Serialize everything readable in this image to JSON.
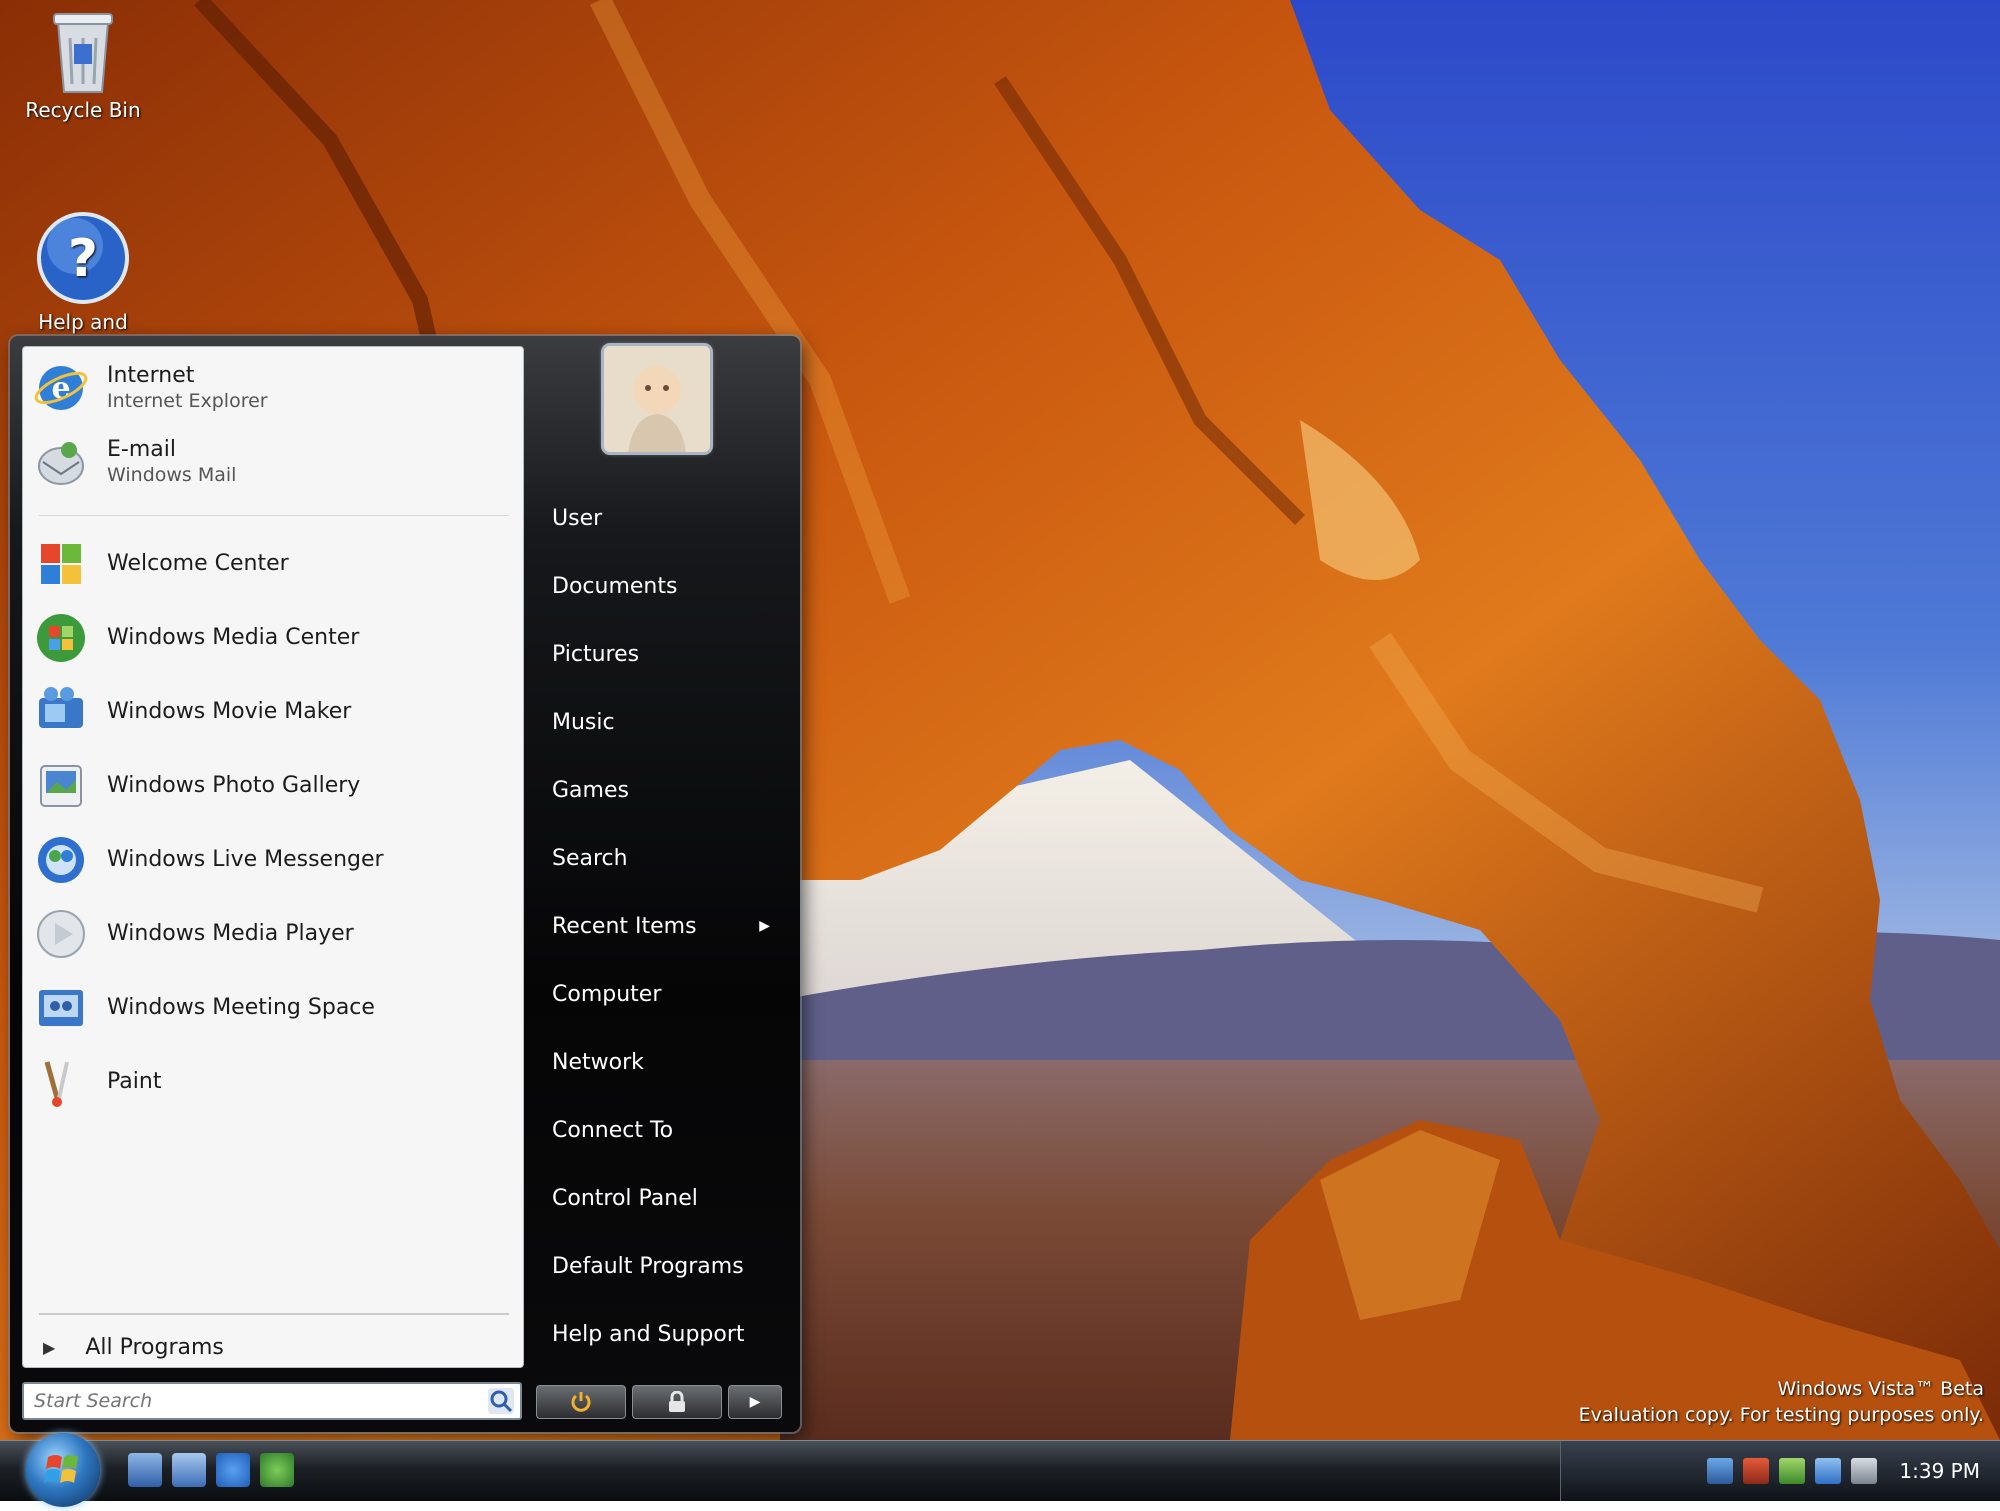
{
  "desktop": {
    "icons": [
      {
        "name": "recycle-bin",
        "label": "Recycle Bin"
      },
      {
        "name": "help",
        "label": "Help and Support"
      }
    ],
    "watermark_line1": "Windows Vista™ Beta",
    "watermark_line2": "Evaluation copy. For testing purposes only."
  },
  "start_menu": {
    "pinned": [
      {
        "title": "Internet",
        "subtitle": "Internet Explorer",
        "icon": "ie-icon"
      },
      {
        "title": "E-mail",
        "subtitle": "Windows Mail",
        "icon": "mail-icon"
      }
    ],
    "recent": [
      {
        "label": "Welcome Center",
        "icon": "welcome-icon"
      },
      {
        "label": "Windows Media Center",
        "icon": "media-center-icon"
      },
      {
        "label": "Windows Movie Maker",
        "icon": "movie-maker-icon"
      },
      {
        "label": "Windows Photo Gallery",
        "icon": "photo-gallery-icon"
      },
      {
        "label": "Windows Live Messenger",
        "icon": "messenger-icon"
      },
      {
        "label": "Windows Media Player",
        "icon": "media-player-icon"
      },
      {
        "label": "Windows Meeting Space",
        "icon": "meeting-space-icon"
      },
      {
        "label": "Paint",
        "icon": "paint-icon"
      }
    ],
    "all_programs": "All Programs",
    "search_placeholder": "Start Search",
    "right_items": [
      {
        "label": "User"
      },
      {
        "label": "Documents"
      },
      {
        "label": "Pictures"
      },
      {
        "label": "Music"
      },
      {
        "label": "Games"
      },
      {
        "label": "Search"
      },
      {
        "label": "Recent Items",
        "submenu": true
      },
      {
        "label": "Computer"
      },
      {
        "label": "Network"
      },
      {
        "label": "Connect To"
      },
      {
        "label": "Control Panel"
      },
      {
        "label": "Default Programs"
      },
      {
        "label": "Help and Support"
      }
    ]
  },
  "taskbar": {
    "clock": "1:39 PM"
  }
}
